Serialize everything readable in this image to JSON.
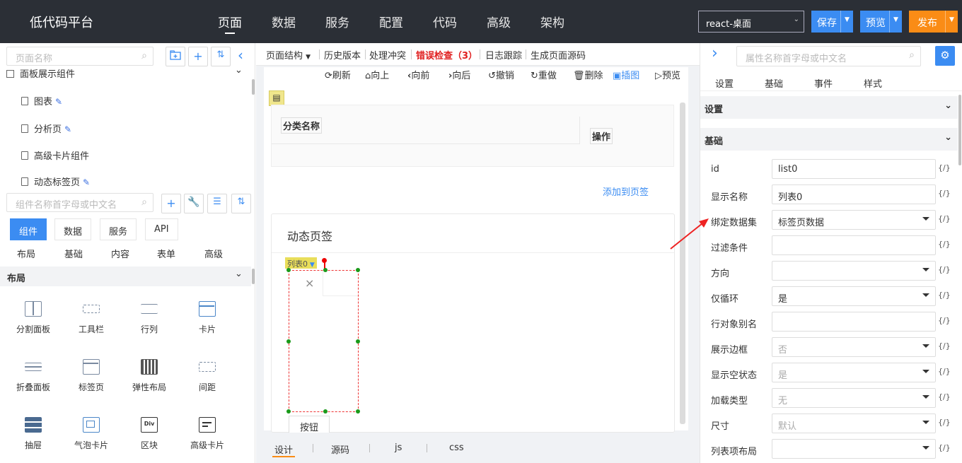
{
  "app_title": "低代码平台",
  "nav": [
    "页面",
    "数据",
    "服务",
    "配置",
    "代码",
    "高级",
    "架构"
  ],
  "platform_select": "react-桌面",
  "header_buttons": {
    "save": "保存",
    "preview": "预览",
    "publish": "发布"
  },
  "left": {
    "page_search_placeholder": "页面名称",
    "section_title": "面板展示组件",
    "tree_items": [
      "图表",
      "分析页",
      "高级卡片组件",
      "动态标签页"
    ],
    "component_search_placeholder": "组件名称首字母或中文名",
    "tabs": [
      "组件",
      "数据",
      "服务",
      "API"
    ],
    "subtabs": [
      "布局",
      "基础",
      "内容",
      "表单",
      "高级"
    ],
    "layout_section": "布局",
    "components": [
      "分割面板",
      "工具栏",
      "行列",
      "卡片",
      "折叠面板",
      "标签页",
      "弹性布局",
      "间距",
      "抽屉",
      "气泡卡片",
      "区块",
      "高级卡片"
    ]
  },
  "center": {
    "toolbar": [
      "页面结构",
      "历史版本",
      "处理冲突",
      "错误检查（3）",
      "日志跟踪",
      "生成页面源码"
    ],
    "canvas_tools": [
      "刷新",
      "向上",
      "向前",
      "向后",
      "撤销",
      "重做",
      "删除",
      "插图",
      "预览"
    ],
    "table_headers": [
      "分类名称",
      "操作"
    ],
    "add_to_page": "添加到页签",
    "card_title": "动态页签",
    "list_tag": "列表0",
    "close_glyph": "×",
    "button_widget": "按钮",
    "bottom_tabs": [
      "设计",
      "源码",
      "js",
      "css"
    ]
  },
  "right": {
    "search_placeholder": "属性名称首字母或中文名",
    "tabs": [
      "设置",
      "基础",
      "事件",
      "样式"
    ],
    "sections": [
      "设置",
      "基础"
    ],
    "fx_label": "{/}",
    "props": [
      {
        "label": "id",
        "value": "list0",
        "type": "input"
      },
      {
        "label": "显示名称",
        "value": "列表0",
        "type": "input"
      },
      {
        "label": "绑定数据集",
        "value": "标签页数据",
        "type": "select"
      },
      {
        "label": "过滤条件",
        "value": "",
        "type": "input"
      },
      {
        "label": "方向",
        "value": "",
        "type": "select"
      },
      {
        "label": "仅循环",
        "value": "是",
        "type": "select"
      },
      {
        "label": "行对象别名",
        "value": "",
        "type": "input"
      },
      {
        "label": "展示边框",
        "value": "否",
        "type": "select-dis"
      },
      {
        "label": "显示空状态",
        "value": "是",
        "type": "select-dis"
      },
      {
        "label": "加载类型",
        "value": "无",
        "type": "select-dis"
      },
      {
        "label": "尺寸",
        "value": "默认",
        "type": "select-dis"
      },
      {
        "label": "列表项布局",
        "value": "",
        "type": "select"
      }
    ]
  }
}
